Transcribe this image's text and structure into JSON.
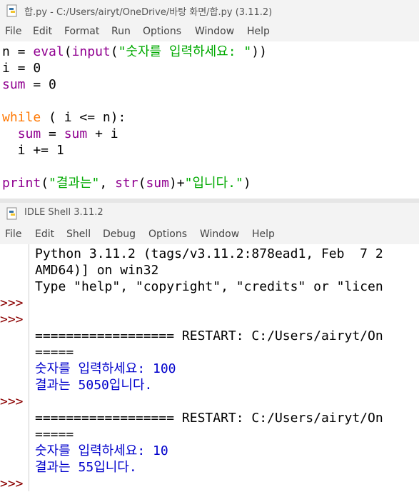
{
  "editor_window": {
    "title": "합.py - C:/Users/airyt/OneDrive/바탕 화면/합.py (3.11.2)",
    "menu": [
      "File",
      "Edit",
      "Format",
      "Run",
      "Options",
      "Window",
      "Help"
    ]
  },
  "code": {
    "line1": {
      "a": "n = ",
      "b": "eval",
      "c": "(",
      "d": "input",
      "e": "(",
      "f": "\"숫자를 입력하세요: \"",
      "g": "))"
    },
    "line2": "i = 0",
    "line3": {
      "a": "sum",
      "b": " = 0"
    },
    "line5": {
      "a": "while",
      "b": " ( i <= n):"
    },
    "line6": {
      "a": "  ",
      "b": "sum",
      "c": " = ",
      "d": "sum",
      "e": " + i"
    },
    "line7": "  i += 1",
    "line9": {
      "a": "print",
      "b": "(",
      "c": "\"결과는\"",
      "d": ", ",
      "e": "str",
      "f": "(",
      "g": "sum",
      "h": ")+",
      "i": "\"입니다.\"",
      "j": ")"
    }
  },
  "shell_window": {
    "title": "IDLE Shell 3.11.2",
    "menu": [
      "File",
      "Edit",
      "Shell",
      "Debug",
      "Options",
      "Window",
      "Help"
    ]
  },
  "shell": {
    "banner1": "Python 3.11.2 (tags/v3.11.2:878ead1, Feb  7 2",
    "banner2": "AMD64)] on win32",
    "banner3": "Type \"help\", \"copyright\", \"credits\" or \"licen",
    "prompt": ">>>",
    "restart1": "================== RESTART: C:/Users/airyt/On",
    "restart1b": "=====",
    "out1a": "숫자를 입력하세요: 100",
    "out1b": "결과는 5050입니다.",
    "restart2": "================== RESTART: C:/Users/airyt/On",
    "restart2b": "=====",
    "out2a": "숫자를 입력하세요: 10",
    "out2b": "결과는 55입니다."
  },
  "colors": {
    "keyword": "#ff7700",
    "builtin": "#900090",
    "string": "#00aa00",
    "prompt": "#8b0000",
    "output": "#0000cc"
  }
}
